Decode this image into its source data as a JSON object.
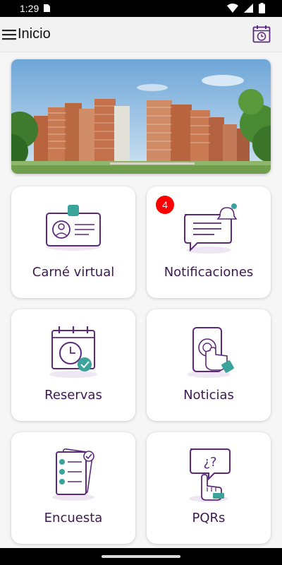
{
  "status_bar": {
    "time": "1:29"
  },
  "app_bar": {
    "title": "Inicio"
  },
  "icons": {
    "menu": "hamburger-menu-icon",
    "calendar": "calendar-clock-icon"
  },
  "colors": {
    "brand_purple": "#5b2a7a",
    "accent_teal": "#3aa39a",
    "badge_red": "#ff0000"
  },
  "cards": [
    {
      "label": "Carné virtual",
      "icon": "id-card-icon"
    },
    {
      "label": "Notificaciones",
      "icon": "notification-chat-icon",
      "badge": "4"
    },
    {
      "label": "Reservas",
      "icon": "calendar-check-icon"
    },
    {
      "label": "Noticias",
      "icon": "phone-touch-icon"
    },
    {
      "label": "Encuesta",
      "icon": "survey-checklist-icon"
    },
    {
      "label": "PQRs",
      "icon": "question-hand-icon"
    }
  ]
}
